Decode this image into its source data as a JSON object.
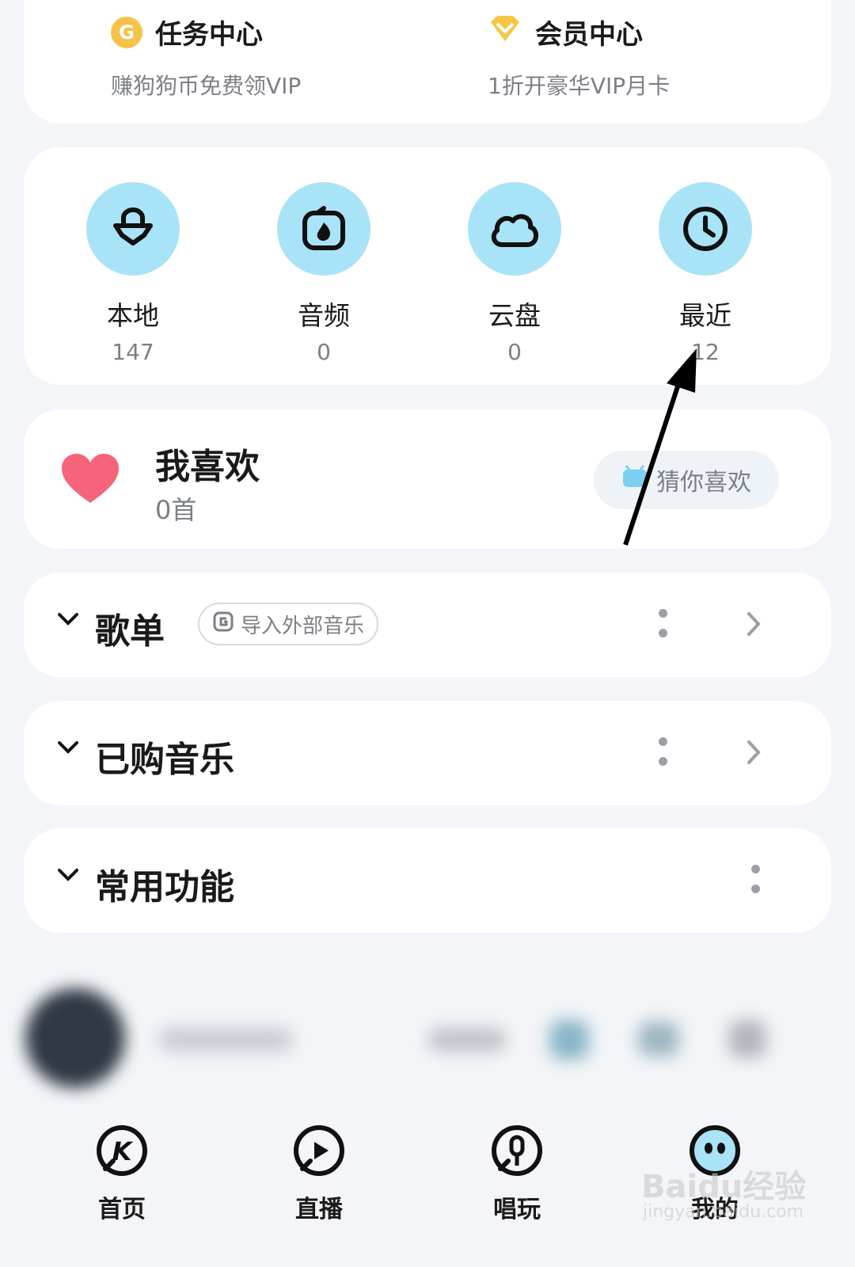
{
  "top_card": {
    "task": {
      "title": "任务中心",
      "subtitle": "赚狗狗币免费领VIP",
      "icon": "coin-icon"
    },
    "member": {
      "title": "会员中心",
      "subtitle": "1折开豪华VIP月卡",
      "icon": "diamond-icon"
    }
  },
  "quick_grid": [
    {
      "label": "本地",
      "count": "147",
      "icon": "local-music-icon"
    },
    {
      "label": "音频",
      "count": "0",
      "icon": "audio-icon"
    },
    {
      "label": "云盘",
      "count": "0",
      "icon": "cloud-icon"
    },
    {
      "label": "最近",
      "count": "12",
      "icon": "clock-icon"
    }
  ],
  "favorites": {
    "title": "我喜欢",
    "count": "0首",
    "guess_button": "猜你喜欢",
    "icon": "heart-icon"
  },
  "sections": {
    "playlist": {
      "title": "歌单",
      "import_button": "导入外部音乐"
    },
    "purchased": {
      "title": "已购音乐"
    },
    "common": {
      "title": "常用功能"
    }
  },
  "bottom_nav": [
    {
      "label": "首页",
      "icon": "home-k-icon"
    },
    {
      "label": "直播",
      "icon": "live-icon"
    },
    {
      "label": "唱玩",
      "icon": "mic-icon"
    },
    {
      "label": "我的",
      "icon": "profile-icon"
    }
  ],
  "watermark": {
    "main": "Baidu经验",
    "sub": "jingyan.baidu.com"
  },
  "colors": {
    "accent_circle": "#a9e3f7",
    "heart": "#f7637a",
    "coin": "#f5c34a",
    "diamond": "#f6c544"
  }
}
